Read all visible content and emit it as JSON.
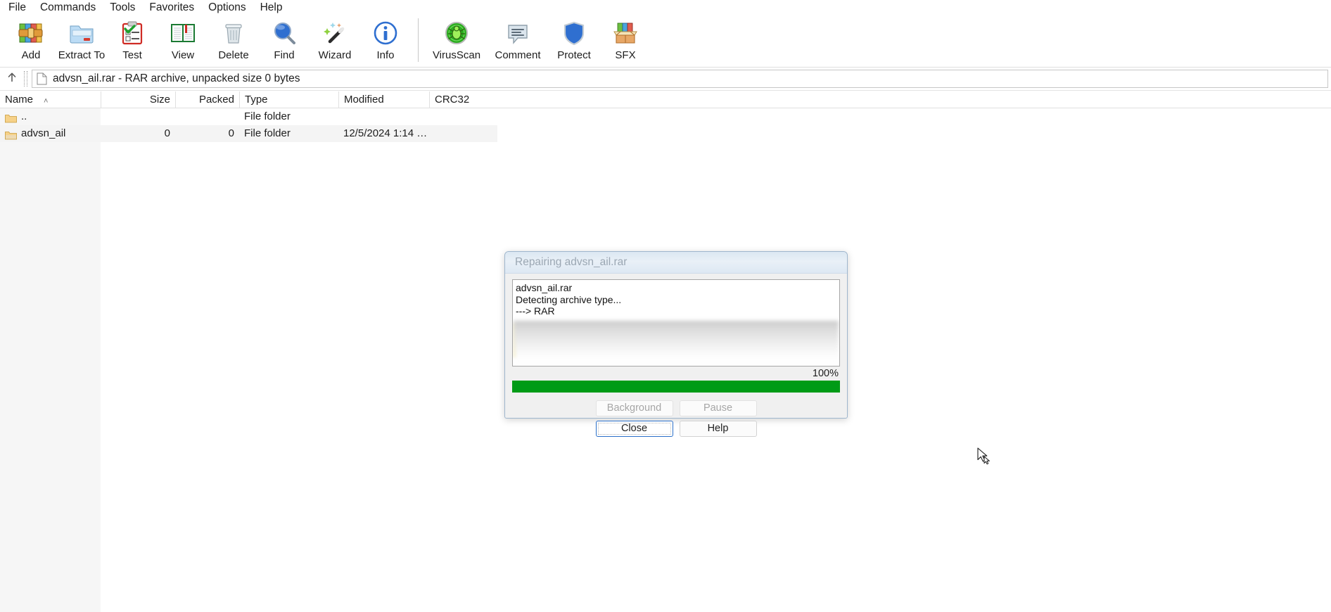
{
  "window": {
    "menu": [
      "File",
      "Commands",
      "Tools",
      "Favorites",
      "Options",
      "Help"
    ]
  },
  "toolbar": {
    "buttons": [
      {
        "label": "Add",
        "icon": "add-archive-icon"
      },
      {
        "label": "Extract To",
        "icon": "extract-folder-icon"
      },
      {
        "label": "Test",
        "icon": "test-clipboard-icon"
      },
      {
        "label": "View",
        "icon": "view-book-icon"
      },
      {
        "label": "Delete",
        "icon": "delete-trash-icon"
      },
      {
        "label": "Find",
        "icon": "find-magnifier-icon"
      },
      {
        "label": "Wizard",
        "icon": "wizard-wand-icon"
      },
      {
        "label": "Info",
        "icon": "info-circle-icon"
      },
      {
        "label": "VirusScan",
        "icon": "virusscan-bug-icon"
      },
      {
        "label": "Comment",
        "icon": "comment-bubble-icon"
      },
      {
        "label": "Protect",
        "icon": "protect-shield-icon"
      },
      {
        "label": "SFX",
        "icon": "sfx-box-icon"
      }
    ]
  },
  "address": {
    "up_icon": "up-arrow-icon",
    "file_icon": "file-document-icon",
    "text": "advsn_ail.rar - RAR archive, unpacked size 0 bytes"
  },
  "filelist": {
    "columns": [
      "Name",
      "Size",
      "Packed",
      "Type",
      "Modified",
      "CRC32"
    ],
    "sort_indicator": "˄",
    "rows": [
      {
        "name": "..",
        "size": "",
        "packed": "",
        "type": "File folder",
        "modified": "",
        "crc32": ""
      },
      {
        "name": "advsn_ail",
        "size": "0",
        "packed": "0",
        "type": "File folder",
        "modified": "12/5/2024 1:14 …",
        "crc32": ""
      }
    ]
  },
  "dialog": {
    "title": "Repairing advsn_ail.rar",
    "log_lines": [
      "advsn_ail.rar",
      "Detecting archive type...",
      "---> RAR"
    ],
    "percent_label": "100%",
    "progress_value": 100,
    "progress_color": "#009b16",
    "buttons": {
      "background": "Background",
      "pause": "Pause",
      "close": "Close",
      "help": "Help"
    }
  },
  "cursor": {
    "icon": "mouse-pointer-icon"
  }
}
